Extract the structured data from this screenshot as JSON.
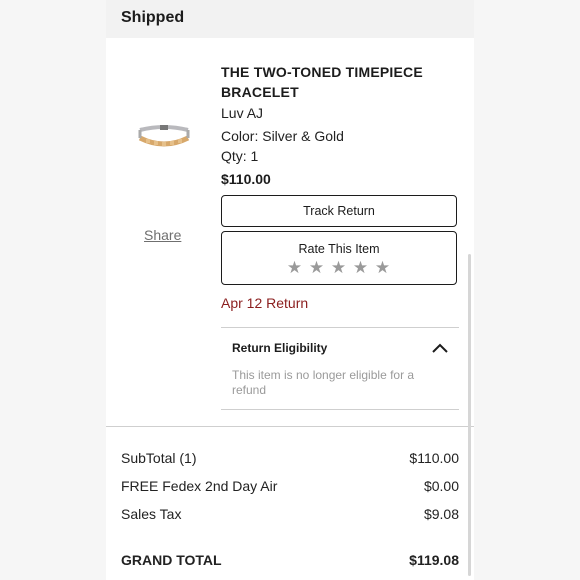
{
  "header": {
    "title": "Shipped"
  },
  "product": {
    "image_alt": "bracelet",
    "title": "THE TWO-TONED TIMEPIECE BRACELET",
    "brand": "Luv AJ",
    "color": "Color: Silver & Gold",
    "qty": "Qty: 1",
    "price": "$110.00",
    "share_label": "Share"
  },
  "actions": {
    "track_return": "Track Return",
    "rate_item": "Rate This Item",
    "stars": [
      "★",
      "★",
      "★",
      "★",
      "★"
    ],
    "rating": 0
  },
  "return_info": {
    "date_label": "Apr 12 Return",
    "eligibility_title": "Return Eligibility",
    "eligibility_text": "This item is no longer eligible for a refund",
    "chevron_icon": "chevron-up-icon"
  },
  "summary": {
    "subtotal_label": "SubTotal (1)",
    "subtotal_value": "$110.00",
    "shipping_label": "FREE Fedex 2nd Day Air",
    "shipping_value": "$0.00",
    "tax_label": "Sales Tax",
    "tax_value": "$9.08",
    "grand_total_label": "GRAND TOTAL",
    "grand_total_value": "$119.08"
  },
  "colors": {
    "return_date": "#8b1e1e",
    "header_bg": "#f2f2f2",
    "stars": "#9a9a9a"
  }
}
